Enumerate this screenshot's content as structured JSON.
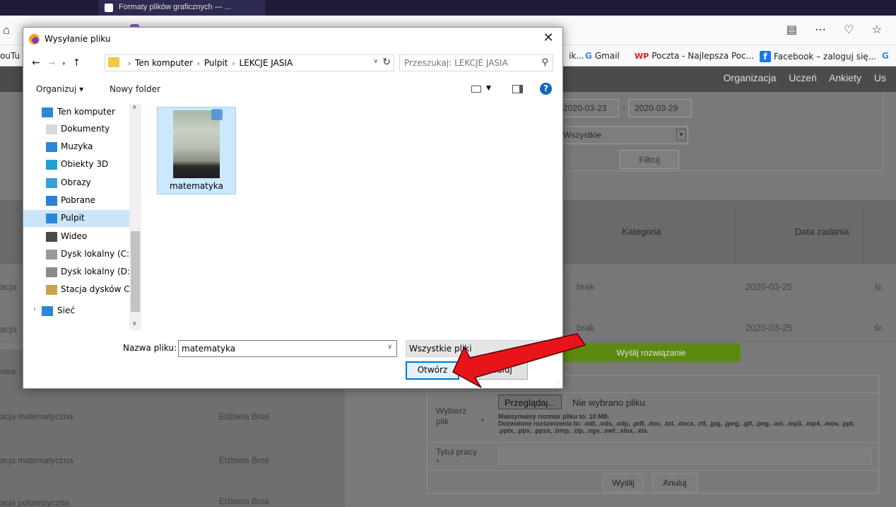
{
  "browser": {
    "tab_title": "Formaty plików graficznych — ...",
    "bookmarks_left": "ouTu",
    "bookmark_cut": "ik...",
    "bookmark_gmail": "Gmail",
    "bookmark_wp": "Poczta - Najlepsza Poc...",
    "bookmark_fb": "Facebook – zaloguj się...",
    "bookmark_last": "G",
    "icons": [
      "home-icon",
      "reader-view-icon",
      "more-icon",
      "pocket-icon",
      "star-icon"
    ]
  },
  "site": {
    "nav": [
      "Organizacja",
      "Uczeń",
      "Ankiety",
      "Us"
    ],
    "filter": {
      "date_from": "2020-03-23",
      "date_sep": "-",
      "date_to": "2020-03-29",
      "select_value": "Wszystkie",
      "button": "Filtruj"
    },
    "table": {
      "headers": {
        "category": "Kategoria",
        "date": "Data zadania"
      },
      "rows": [
        {
          "left": "acja",
          "category": "brak",
          "date": "2020-03-25",
          "extra": "śr."
        },
        {
          "left": "acja",
          "category": "brak",
          "date": "2020-03-25",
          "extra": "śr."
        }
      ]
    },
    "left_list": [
      {
        "subject": "owa",
        "teacher": ""
      },
      {
        "subject": "acja matematyczna",
        "teacher": "Elżbieta Broś"
      },
      {
        "subject": "acja matematyczna",
        "teacher": "Elżbieta Broś"
      },
      {
        "subject": "acja polonistyczna",
        "teacher": "Elżbieta Broś"
      }
    ],
    "solution_button": "Wyślij rozwiązanie",
    "upload": {
      "file_label": "Wybierz plik",
      "required_mark": "*",
      "browse_button": "Przeglądaj...",
      "no_file": "Nie wybrano pliku.",
      "max_size": "Maksymalny rozmiar pliku to: 10 MB.",
      "allowed": "Dozwolone rozszerzenia to: .odt, .ods, .odp, .pdf, .doc, .txt, .docx, .rtf, .jpg, .jpeg, .gif, .png, .avi, .mp3, .mp4, .mov, .ppt, .pptx, .pps, .ppsx, .bmp, .zip, .ogv, .swf, .xlsx, .xls.",
      "title_label": "Tytuł pracy",
      "title_value": "",
      "send_button": "Wyślij",
      "cancel_button": "Anuluj"
    }
  },
  "dialog": {
    "title": "Wysyłanie pliku",
    "close": "✕",
    "breadcrumbs": [
      "Ten komputer",
      "Pulpit",
      "LEKCJE JASIA"
    ],
    "search_placeholder": "Przeszukaj: LEKCJE JASIA",
    "organize": "Organizuj ▾",
    "new_folder": "Nowy folder",
    "nav_items": [
      {
        "label": "Ten komputer",
        "icon": "computer-icon"
      },
      {
        "label": "Dokumenty",
        "icon": "documents-icon"
      },
      {
        "label": "Muzyka",
        "icon": "music-icon"
      },
      {
        "label": "Obiekty 3D",
        "icon": "3d-objects-icon"
      },
      {
        "label": "Obrazy",
        "icon": "pictures-icon"
      },
      {
        "label": "Pobrane",
        "icon": "downloads-icon"
      },
      {
        "label": "Pulpit",
        "icon": "desktop-icon",
        "selected": true
      },
      {
        "label": "Wideo",
        "icon": "video-icon"
      },
      {
        "label": "Dysk lokalny (C:)",
        "icon": "drive-c-icon"
      },
      {
        "label": "Dysk lokalny (D:)",
        "icon": "drive-d-icon"
      },
      {
        "label": "Stacja dysków C",
        "icon": "dvd-drive-icon"
      },
      {
        "label": "Sieć",
        "icon": "network-icon"
      }
    ],
    "file": {
      "name": "matematyka",
      "icon": "image-file-icon"
    },
    "filename_label": "Nazwa pliku:",
    "filename_value": "matematyka",
    "filetype": "Wszystkie pliki",
    "open_button": "Otwórz",
    "cancel_button": "Anuluj"
  },
  "colors": {
    "annotation_arrow": "#e8141a",
    "selection": "#cce8ff",
    "accent": "#0078d7",
    "solution_button": "#5c8a10"
  }
}
